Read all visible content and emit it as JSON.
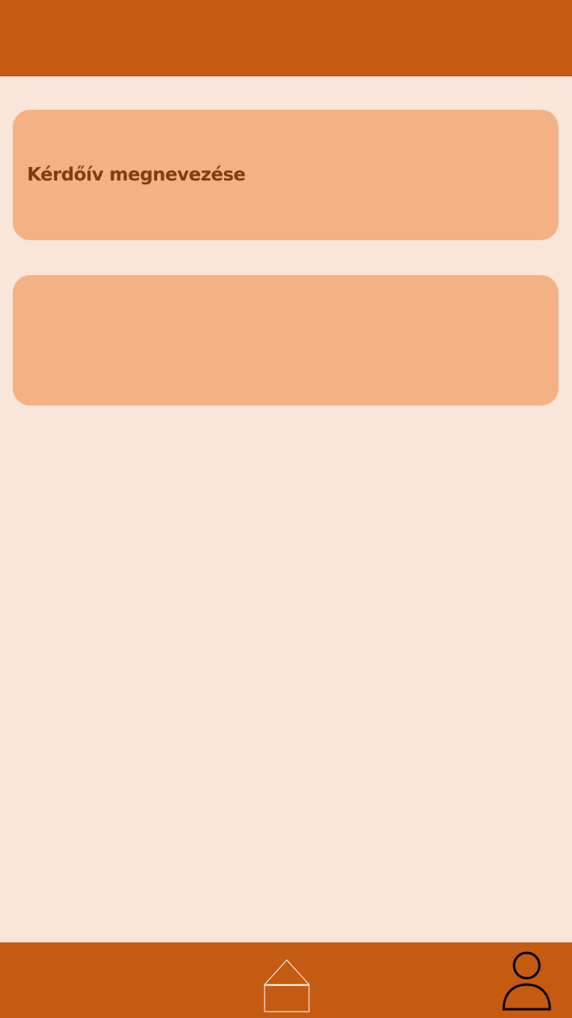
{
  "header": {},
  "cards": [
    {
      "title": "Kérdőív megnevezése"
    },
    {
      "title": ""
    }
  ],
  "bottom_nav": {
    "home_icon": "home-icon",
    "profile_icon": "user-profile-icon"
  },
  "colors": {
    "primary": "#c55a11",
    "background": "#f9e5d9",
    "card": "#f4b183",
    "card_text": "#843c0c"
  }
}
